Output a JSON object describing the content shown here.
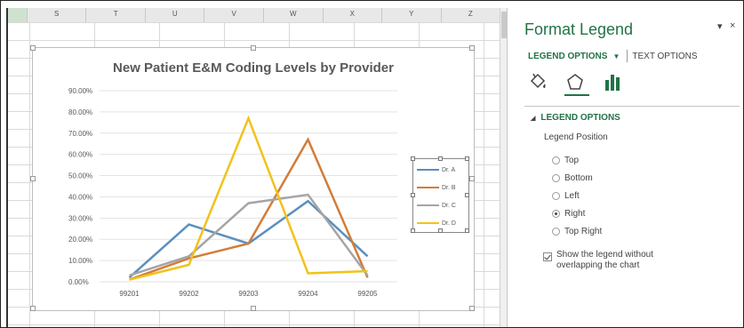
{
  "spreadsheet": {
    "column_headers": [
      "",
      "S",
      "T",
      "U",
      "V",
      "W",
      "X",
      "Y",
      "Z"
    ]
  },
  "chart_data": {
    "type": "line",
    "title": "New Patient E&M Coding Levels by Provider",
    "categories": [
      "99201",
      "99202",
      "99203",
      "99204",
      "99205"
    ],
    "y_tick_labels": [
      "0.00%",
      "10.00%",
      "20.00%",
      "30.00%",
      "40.00%",
      "50.00%",
      "60.00%",
      "70.00%",
      "80.00%",
      "90.00%"
    ],
    "ylim": [
      0,
      90
    ],
    "series": [
      {
        "name": "Dr. A",
        "color": "#5b8fbf",
        "values": [
          2,
          27,
          18,
          38,
          12
        ]
      },
      {
        "name": "Dr. B",
        "color": "#d27d3a",
        "values": [
          1,
          11,
          18,
          67,
          2
        ]
      },
      {
        "name": "Dr. C",
        "color": "#a5a5a5",
        "values": [
          3,
          12,
          37,
          41,
          3
        ]
      },
      {
        "name": "Dr. D",
        "color": "#f2c21a",
        "values": [
          1,
          8,
          77,
          4,
          5
        ]
      }
    ],
    "legend_position": "right",
    "grid": true
  },
  "pane": {
    "title": "Format Legend",
    "pin_icon": "dropdown-arrow-icon",
    "close_label": "×",
    "tabs": {
      "active": "LEGEND OPTIONS",
      "other": "TEXT OPTIONS"
    },
    "section_title": "LEGEND OPTIONS",
    "position_label": "Legend Position",
    "position_options": [
      {
        "label": "Top",
        "selected": false
      },
      {
        "label": "Bottom",
        "selected": false
      },
      {
        "label": "Left",
        "selected": false
      },
      {
        "label": "Right",
        "selected": true
      },
      {
        "label": "Top Right",
        "selected": false
      }
    ],
    "overlap_checkbox": {
      "label": "Show the legend without overlapping the chart",
      "checked": true
    },
    "accent_color": "#217346"
  }
}
